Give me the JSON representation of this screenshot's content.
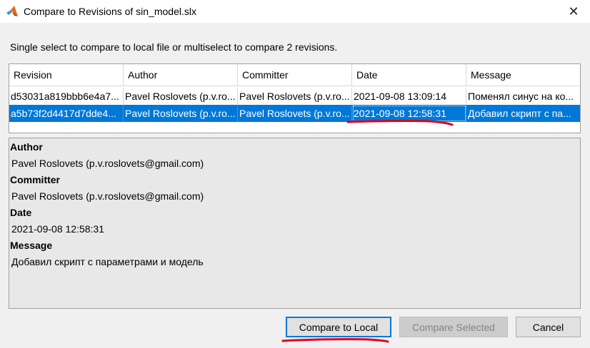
{
  "window": {
    "title": "Compare to Revisions of sin_model.slx",
    "close_glyph": "✕"
  },
  "instructions": "Single select to compare to local file or multiselect to compare 2 revisions.",
  "table": {
    "columns": [
      "Revision",
      "Author",
      "Committer",
      "Date",
      "Message"
    ],
    "rows": [
      {
        "revision": "d53031a819bbb6e4a7...",
        "author": "Pavel Roslovets (p.v.ro...",
        "committer": "Pavel Roslovets (p.v.ro...",
        "date": "2021-09-08 13:09:14",
        "message": "Поменял синус на ко..."
      },
      {
        "revision": "a5b73f2d4417d7dde4...",
        "author": "Pavel Roslovets (p.v.ro...",
        "committer": "Pavel Roslovets (p.v.ro...",
        "date": "2021-09-08 12:58:31",
        "message": "Добавил скрипт с па...",
        "selected": true
      }
    ]
  },
  "details": {
    "author_label": "Author",
    "author_value": "Pavel Roslovets (p.v.roslovets@gmail.com)",
    "committer_label": "Committer",
    "committer_value": "Pavel Roslovets (p.v.roslovets@gmail.com)",
    "date_label": "Date",
    "date_value": "2021-09-08 12:58:31",
    "message_label": "Message",
    "message_value": "Добавил скрипт с параметрами и модель"
  },
  "buttons": {
    "compare_local": "Compare to Local",
    "compare_selected": "Compare Selected",
    "cancel": "Cancel"
  },
  "colors": {
    "selection": "#0078d7",
    "annotation": "#e0001b"
  }
}
